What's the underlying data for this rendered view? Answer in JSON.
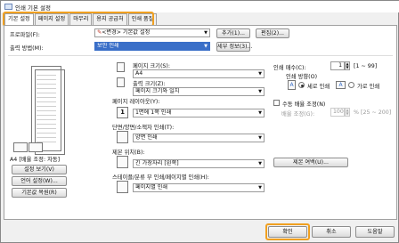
{
  "window": {
    "title": "인쇄 기본 설정"
  },
  "tabs": [
    "기본 설정",
    "페이지 설정",
    "마무리",
    "용지 공급처",
    "인쇄 품질"
  ],
  "profile": {
    "label": "프로파일(F):",
    "value": "<변경> 기본값 설정",
    "add": "추가(1)...",
    "edit": "편집(2)..."
  },
  "output": {
    "label": "출력 방법(M):",
    "value": "보안 인쇄",
    "detail": "세부 정보(3)..."
  },
  "preview": {
    "caption": "A4 [배율 조정: 자동]",
    "view_settings": "설정 보기(V)",
    "language": "언어 설정(W)...",
    "restore": "기본값 복원(R)"
  },
  "page_size": {
    "label": "페이지 크기(S):",
    "value": "A4"
  },
  "output_size": {
    "label": "출력 크기(Z):",
    "value": "페이지 크기와 일치"
  },
  "layout": {
    "label": "페이지 레이아웃(Y):",
    "value": "1면에 1쪽 인쇄",
    "icon_text": "1"
  },
  "duplex": {
    "label": "단면/양면/소책자 인쇄(T):",
    "value": "양면 인쇄"
  },
  "binding": {
    "label": "제본 위치(B):",
    "value": "긴 가장자리 [왼쪽]",
    "margin_button": "제본 여백(U)..."
  },
  "stapling": {
    "label": "스테이플/분류 부 인쇄/페이지별 인쇄(H):",
    "value": "페이지별 인쇄"
  },
  "copies": {
    "label": "인쇄 매수(C):",
    "value": "1",
    "range": "[1 ~ 99]"
  },
  "orientation": {
    "label": "인쇄 방향(O)",
    "portrait": "세로 인쇄",
    "landscape": "가로 인쇄",
    "portrait_icon": "A",
    "landscape_icon": "A"
  },
  "manual_scale": {
    "label": "수동 배율 조정(N)",
    "scale_label": "배율 조정(G):",
    "value": "100",
    "range": "% [25 ~ 200]"
  },
  "footer": {
    "ok": "확인",
    "cancel": "취소",
    "help": "도움말"
  }
}
